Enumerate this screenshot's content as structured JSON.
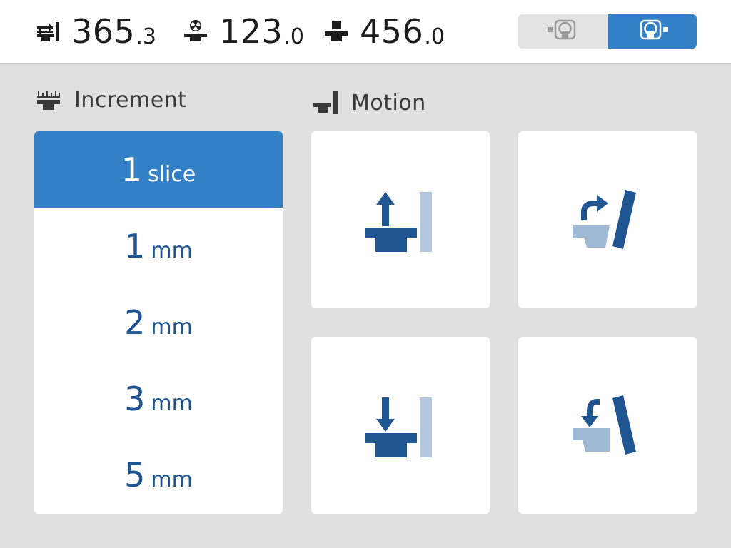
{
  "colors": {
    "accent": "#3480c6",
    "dark_blue": "#1f5591",
    "light_blue": "#9fb8d4",
    "background": "#e0e0e0",
    "panel": "#ffffff",
    "text": "#1d1d1d"
  },
  "readouts": [
    {
      "icon": "table-longitudinal-icon",
      "main": "365",
      "frac": ".3"
    },
    {
      "icon": "table-radiation-height-icon",
      "main": "123",
      "frac": ".0"
    },
    {
      "icon": "table-height-icon",
      "main": "456",
      "frac": ".0"
    }
  ],
  "view_toggle": {
    "options": [
      {
        "icon": "gantry-front-view-icon",
        "selected": false
      },
      {
        "icon": "gantry-rear-view-icon",
        "selected": true
      }
    ]
  },
  "increment": {
    "title": "Increment",
    "icon": "increment-ruler-icon",
    "items": [
      {
        "num": "1",
        "unit": "slice",
        "selected": true
      },
      {
        "num": "1",
        "unit": "mm",
        "selected": false
      },
      {
        "num": "2",
        "unit": "mm",
        "selected": false
      },
      {
        "num": "3",
        "unit": "mm",
        "selected": false
      },
      {
        "num": "5",
        "unit": "mm",
        "selected": false
      }
    ]
  },
  "motion": {
    "title": "Motion",
    "icon": "table-gantry-icon",
    "buttons": [
      {
        "id": "up",
        "icon": "table-up-icon"
      },
      {
        "id": "tilt-forward",
        "icon": "gantry-tilt-forward-icon"
      },
      {
        "id": "down",
        "icon": "table-down-icon"
      },
      {
        "id": "tilt-back",
        "icon": "gantry-tilt-back-icon"
      }
    ]
  }
}
